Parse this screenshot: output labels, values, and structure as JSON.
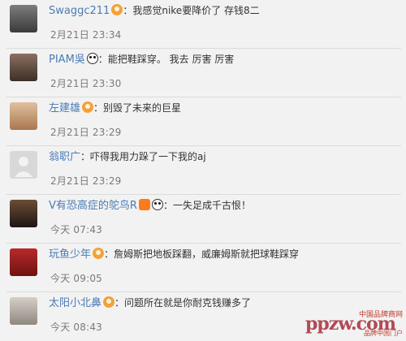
{
  "comments": [
    {
      "user": "Swaggc211",
      "badge": "orange",
      "text": "我感觉nike要降价了 存钱8二",
      "time": "2月21日 23:34",
      "avatar_bg": "#6a6a6a"
    },
    {
      "user": "PIAM吳",
      "badge": "panda",
      "text": "能把鞋踩穿。 我去 厉害 厉害",
      "time": "2月21日 23:30",
      "avatar_bg": "#5d4c44"
    },
    {
      "user": "左建雄",
      "badge": "orange",
      "text": "别毁了未来的巨星",
      "time": "2月21日 23:29",
      "avatar_bg": "#c9a27d"
    },
    {
      "user": "翁职广",
      "badge": "",
      "text": "吓得我用力跺了一下我的aj",
      "time": "2月21日 23:29",
      "avatar_bg": "#d5d5d5"
    },
    {
      "user": "V有恐高症的鸵鸟R",
      "badge": "fire-panda",
      "text": "一失足成千古恨！",
      "time": "今天 07:43",
      "avatar_bg": "#4a3526"
    },
    {
      "user": "玩鱼少年",
      "badge": "orange",
      "text": "詹姆斯把地板踩翻，威廉姆斯就把球鞋踩穿",
      "time": "今天 09:05",
      "avatar_bg": "#9a1f1f"
    },
    {
      "user": "太阳小北鼻",
      "badge": "orange",
      "text": "问题所在就是你耐克钱赚多了",
      "time": "今天 08:43",
      "avatar_bg": "#bfb6ad"
    }
  ],
  "watermark": {
    "brand": "中国品牌商网",
    "logo": "ppzw.com",
    "sub": "品牌中国门户"
  }
}
